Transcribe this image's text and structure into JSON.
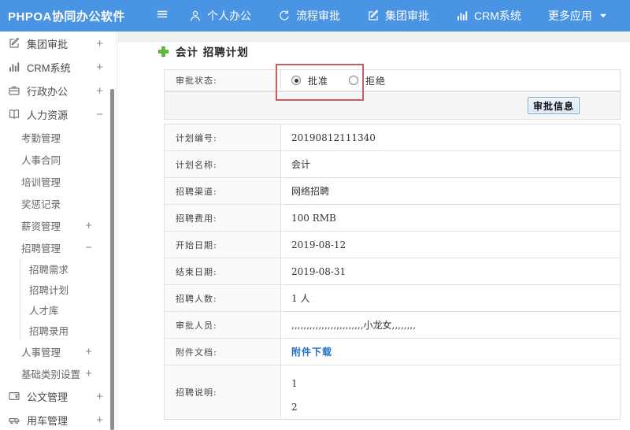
{
  "colors": {
    "header_bg": "#4a94e4",
    "accent_green": "#62bb36",
    "link_blue": "#2471c8",
    "annotation_red": "#c2606a",
    "button_bg": "#d6e7f8",
    "button_border": "#7da7d0"
  },
  "header": {
    "app_title": "PHPOA协同办公软件",
    "nav": [
      {
        "label": "个人办公",
        "icon": "user"
      },
      {
        "label": "流程审批",
        "icon": "workflow"
      },
      {
        "label": "集团审批",
        "icon": "edit"
      },
      {
        "label": "CRM系统",
        "icon": "chart"
      },
      {
        "label": "更多应用",
        "icon": "caret"
      }
    ]
  },
  "sidebar": {
    "items": [
      {
        "label": "集团审批",
        "icon": "edit",
        "toggle": "+",
        "level": 0
      },
      {
        "label": "CRM系统",
        "icon": "chart",
        "toggle": "+",
        "level": 0
      },
      {
        "label": "行政办公",
        "icon": "briefcase",
        "toggle": "+",
        "level": 0
      },
      {
        "label": "人力资源",
        "icon": "book",
        "toggle": "−",
        "level": 0
      },
      {
        "label": "考勤管理",
        "level": 1
      },
      {
        "label": "人事合同",
        "level": 1
      },
      {
        "label": "培训管理",
        "level": 1
      },
      {
        "label": "奖惩记录",
        "level": 1
      },
      {
        "label": "薪资管理",
        "toggle": "+",
        "level": 1
      },
      {
        "label": "招聘管理",
        "toggle": "−",
        "level": 1
      },
      {
        "label": "招聘需求",
        "level": 2
      },
      {
        "label": "招聘计划",
        "level": 2
      },
      {
        "label": "人才库",
        "level": 2
      },
      {
        "label": "招聘录用",
        "level": 2
      },
      {
        "label": "人事管理",
        "toggle": "+",
        "level": 1
      },
      {
        "label": "基础类别设置",
        "toggle": "+",
        "level": 1
      },
      {
        "label": "公文管理",
        "icon": "doc",
        "toggle": "+",
        "level": 0
      },
      {
        "label": "用车管理",
        "icon": "car",
        "toggle": "+",
        "level": 0
      }
    ]
  },
  "main": {
    "title": "会计 招聘计划",
    "status_row": {
      "label": "审批状态:",
      "options": [
        {
          "label": "批准",
          "selected": true
        },
        {
          "label": "拒绝",
          "selected": false
        }
      ]
    },
    "button_label": "审批信息",
    "rows": [
      {
        "label": "计划编号:",
        "value": "20190812111340"
      },
      {
        "label": "计划名称:",
        "value": "会计"
      },
      {
        "label": "招聘渠道:",
        "value": "网络招聘"
      },
      {
        "label": "招聘费用:",
        "value": "100 RMB"
      },
      {
        "label": "开始日期:",
        "value": "2019-08-12"
      },
      {
        "label": "结束日期:",
        "value": "2019-08-31"
      },
      {
        "label": "招聘人数:",
        "value": "1 人"
      },
      {
        "label": "审批人员:",
        "value": ",,,,,,,,,,,,,,,,,,,,,,,,小龙女,,,,,,,,"
      },
      {
        "label": "附件文档:",
        "value": "附件下载",
        "link": true
      },
      {
        "label": "招聘说明:",
        "lines": [
          "1",
          "2"
        ],
        "multiline": true
      }
    ]
  }
}
